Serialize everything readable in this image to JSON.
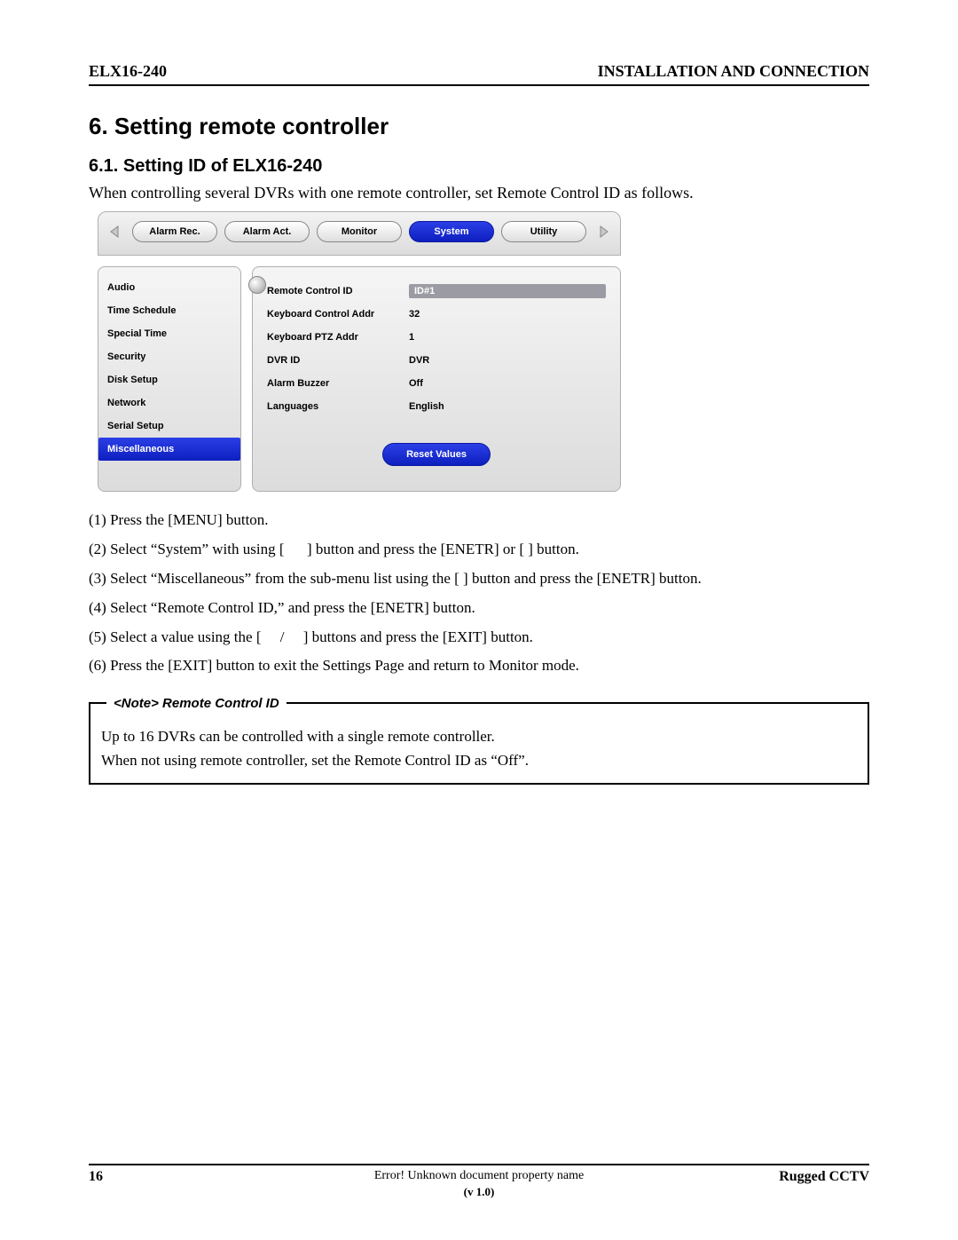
{
  "header": {
    "left": "ELX16-240",
    "right": "INSTALLATION AND CONNECTION"
  },
  "section": {
    "title": "6.  Setting remote controller",
    "subtitle": "6.1.  Setting ID of ELX16-240",
    "intro": "When controlling several DVRs with one remote controller, set Remote Control ID as follows."
  },
  "ui": {
    "tabs": [
      {
        "label": "Alarm Rec.",
        "active": false
      },
      {
        "label": "Alarm Act.",
        "active": false
      },
      {
        "label": "Monitor",
        "active": false
      },
      {
        "label": "System",
        "active": true
      },
      {
        "label": "Utility",
        "active": false
      }
    ],
    "sidebar": [
      {
        "label": "Audio",
        "selected": false
      },
      {
        "label": "Time Schedule",
        "selected": false
      },
      {
        "label": "Special Time",
        "selected": false
      },
      {
        "label": "Security",
        "selected": false
      },
      {
        "label": "Disk Setup",
        "selected": false
      },
      {
        "label": "Network",
        "selected": false
      },
      {
        "label": "Serial Setup",
        "selected": false
      },
      {
        "label": "Miscellaneous",
        "selected": true
      }
    ],
    "fields": [
      {
        "label": "Remote Control ID",
        "value": "ID#1",
        "highlight": true
      },
      {
        "label": "Keyboard Control Addr",
        "value": "32"
      },
      {
        "label": "Keyboard PTZ Addr",
        "value": "1"
      },
      {
        "label": "DVR ID",
        "value": "DVR"
      },
      {
        "label": "Alarm Buzzer",
        "value": "Off"
      },
      {
        "label": "Languages",
        "value": "English"
      }
    ],
    "reset_label": "Reset Values"
  },
  "steps": [
    "(1)  Press the [MENU] button.",
    "(2)  Select “System” with using [      ] button and press the [ENETR] or [ ] button.",
    "(3)  Select “Miscellaneous” from the sub-menu list using the [ ] button and press the [ENETR] button.",
    "(4)  Select “Remote Control ID,” and press the [ENETR] button.",
    "(5)  Select a value using the [     /     ] buttons and press the [EXIT] button.",
    "(6)  Press the [EXIT] button to exit the Settings Page and return to Monitor mode."
  ],
  "note": {
    "label": "<Note> Remote Control ID",
    "line1": "Up to 16 DVRs can be controlled with a single remote controller.",
    "line2": "When not using remote controller, set the Remote Control ID as “Off”."
  },
  "footer": {
    "page": "16",
    "center": "Error! Unknown document property name",
    "right": "Rugged CCTV",
    "version": "(v 1.0)"
  }
}
